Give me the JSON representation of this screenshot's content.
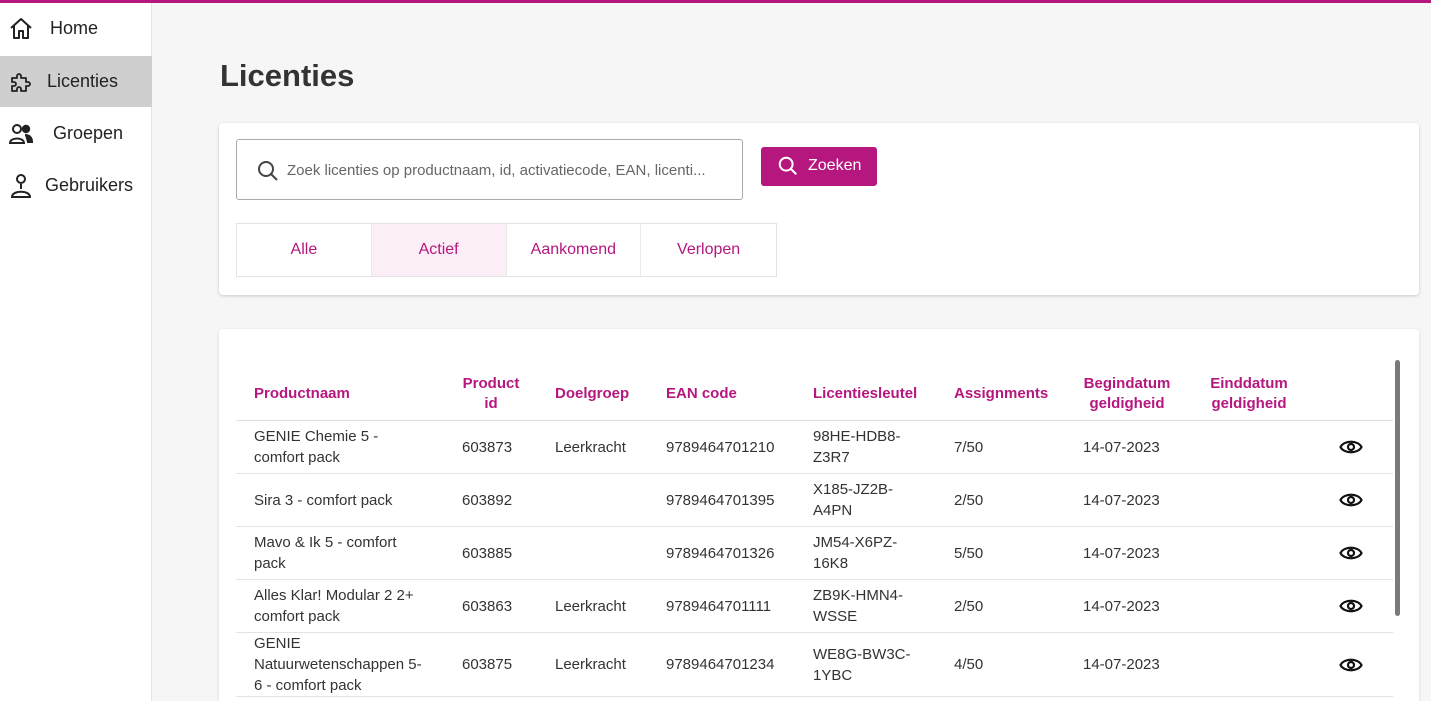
{
  "nav": {
    "items": [
      {
        "label": "Home",
        "icon": "home-icon",
        "active": false
      },
      {
        "label": "Licenties",
        "icon": "puzzle-icon",
        "active": true
      },
      {
        "label": "Groepen",
        "icon": "users-icon",
        "active": false
      },
      {
        "label": "Gebruikers",
        "icon": "user-icon",
        "active": false
      }
    ]
  },
  "page": {
    "title": "Licenties"
  },
  "search": {
    "placeholder": "Zoek licenties op productnaam, id, activatiecode, EAN, licenti...",
    "value": "",
    "button_label": "Zoeken"
  },
  "filters": {
    "tabs": [
      "Alle",
      "Actief",
      "Aankomend",
      "Verlopen"
    ],
    "selected": "Actief"
  },
  "table": {
    "columns": {
      "productnaam": "Productnaam",
      "product_id": "Product id",
      "doelgroep": "Doelgroep",
      "ean": "EAN code",
      "licentiesleutel": "Licentiesleutel",
      "assignments": "Assignments",
      "begindatum": "Begindatum geldigheid",
      "einddatum": "Einddatum geldigheid"
    },
    "rows": [
      {
        "productnaam": "GENIE Chemie 5 - comfort pack",
        "product_id": "603873",
        "doelgroep": "Leerkracht",
        "ean": "9789464701210",
        "licentiesleutel": "98HE-HDB8-Z3R7",
        "assignments": "7/50",
        "begindatum": "14-07-2023",
        "einddatum": ""
      },
      {
        "productnaam": "Sira 3 - comfort pack",
        "product_id": "603892",
        "doelgroep": "",
        "ean": "9789464701395",
        "licentiesleutel": "X185-JZ2B-A4PN",
        "assignments": "2/50",
        "begindatum": "14-07-2023",
        "einddatum": ""
      },
      {
        "productnaam": "Mavo & Ik 5 - comfort pack",
        "product_id": "603885",
        "doelgroep": "",
        "ean": "9789464701326",
        "licentiesleutel": "JM54-X6PZ-16K8",
        "assignments": "5/50",
        "begindatum": "14-07-2023",
        "einddatum": ""
      },
      {
        "productnaam": "Alles Klar! Modular 2 2+ comfort pack",
        "product_id": "603863",
        "doelgroep": "Leerkracht",
        "ean": "9789464701111",
        "licentiesleutel": "ZB9K-HMN4-WSSE",
        "assignments": "2/50",
        "begindatum": "14-07-2023",
        "einddatum": ""
      },
      {
        "productnaam": "GENIE Natuurwetenschappen 5-6 - comfort pack",
        "product_id": "603875",
        "doelgroep": "Leerkracht",
        "ean": "9789464701234",
        "licentiesleutel": "WE8G-BW3C-1YBC",
        "assignments": "4/50",
        "begindatum": "14-07-2023",
        "einddatum": ""
      }
    ]
  },
  "colors": {
    "accent": "#b5177f",
    "active_nav": "#cfcfcf",
    "selected_tab": "#fbeef7"
  }
}
